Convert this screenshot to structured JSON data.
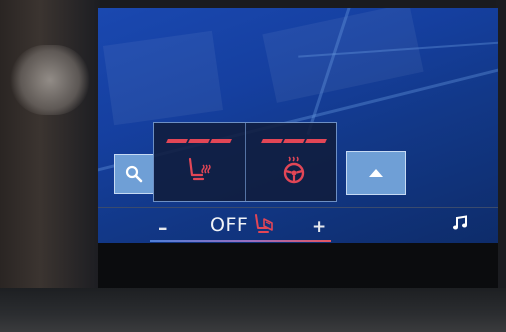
{
  "climate": {
    "fan_minus": "–",
    "fan_value": "OFF",
    "fan_plus": "+"
  },
  "popup": {
    "seat_heating_level": 3,
    "steering_heating_level": 3
  },
  "icons": {
    "search": "search-icon",
    "seat_heat": "seat-heating-icon",
    "steering_heat": "steering-wheel-heating-icon",
    "seat_climate": "seat-climate-icon",
    "up": "chevron-up-icon",
    "music": "music-note-icon"
  },
  "colors": {
    "accent_red": "#e24656",
    "button_blue": "#6f9fd6",
    "map_blue": "#1a48b0"
  }
}
